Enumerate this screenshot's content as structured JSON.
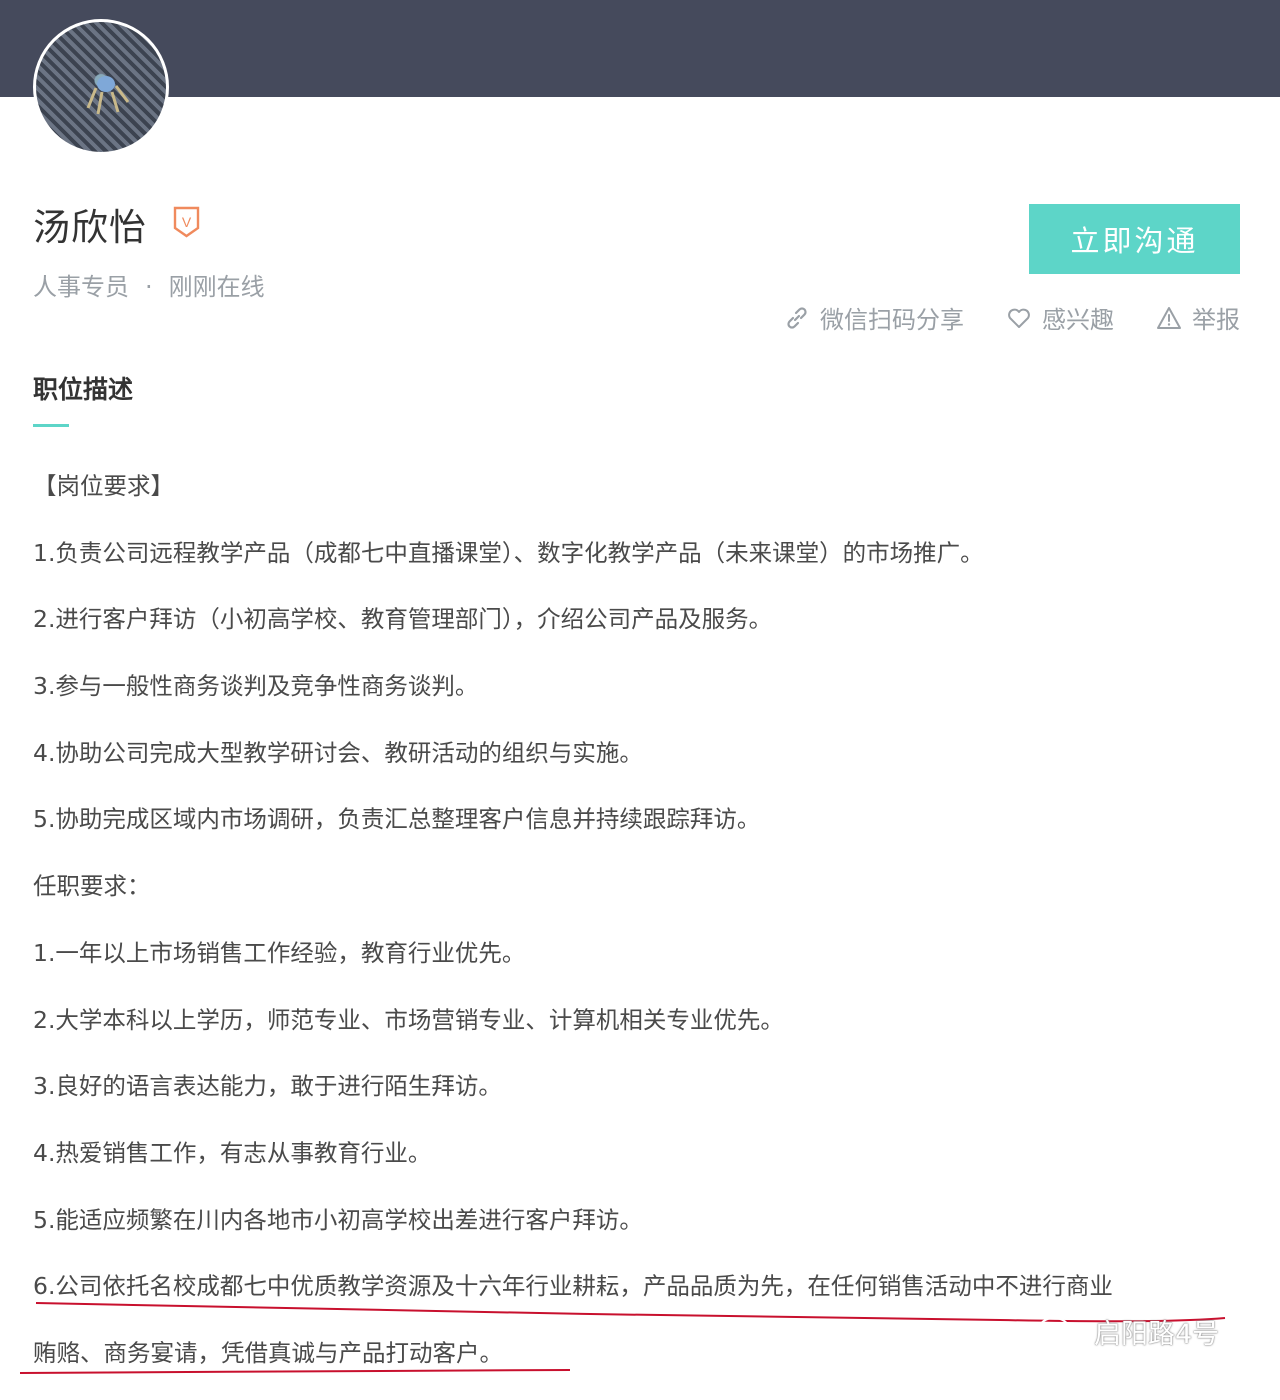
{
  "profile": {
    "name": "汤欣怡",
    "badge": "V",
    "role": "人事专员",
    "separator": "·",
    "status": "刚刚在线"
  },
  "actions": {
    "chat_label": "立即沟通",
    "share_label": "微信扫码分享",
    "interest_label": "感兴趣",
    "report_label": "举报"
  },
  "section": {
    "title": "职位描述"
  },
  "description": [
    "【岗位要求】",
    "1.负责公司远程教学产品（成都七中直播课堂）、数字化教学产品（未来课堂）的市场推广。",
    "2.进行客户拜访（小初高学校、教育管理部门），介绍公司产品及服务。",
    "3.参与一般性商务谈判及竞争性商务谈判。",
    "4.协助公司完成大型教学研讨会、教研活动的组织与实施。",
    "5.协助完成区域内市场调研，负责汇总整理客户信息并持续跟踪拜访。",
    "任职要求：",
    "1.一年以上市场销售工作经验，教育行业优先。",
    "2.大学本科以上学历，师范专业、市场营销专业、计算机相关专业优先。",
    "3.良好的语言表达能力，敢于进行陌生拜访。",
    "4.热爱销售工作，有志从事教育行业。",
    "5.能适应频繁在川内各地市小初高学校出差进行客户拜访。",
    "6.公司依托名校成都七中优质教学资源及十六年行业耕耘，产品品质为先，在任何销售活动中不进行商业",
    "贿赂、商务宴请，凭借真诚与产品打动客户。"
  ],
  "watermark": "启阳路4号",
  "colors": {
    "accent": "#5dd5c8",
    "topbar": "#454a5c",
    "annotation": "#c8102e",
    "badge": "#f08a5d"
  }
}
